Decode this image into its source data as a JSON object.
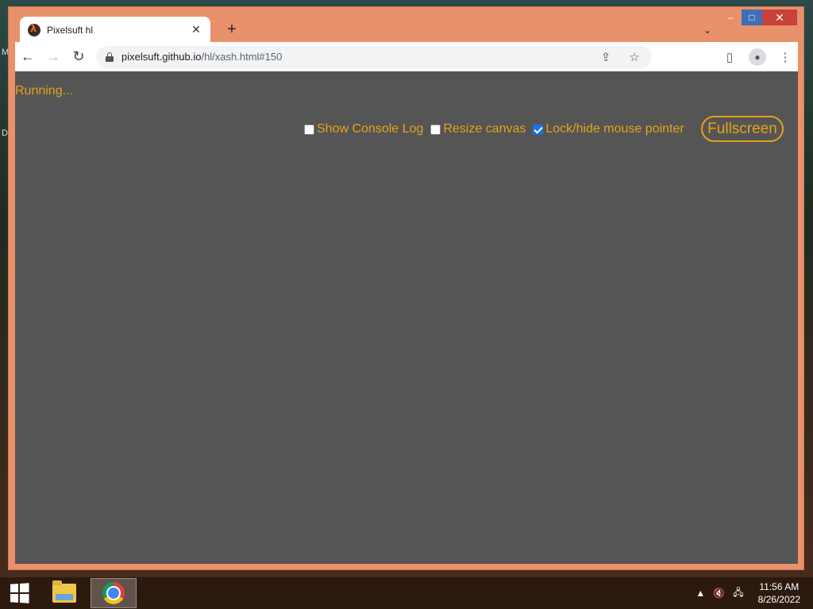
{
  "desktop": {
    "edge_labels": [
      "M",
      "D"
    ]
  },
  "browser": {
    "tab": {
      "title": "Pixelsuft hl",
      "favicon": "half-life-lambda-icon"
    },
    "new_tab_label": "+",
    "tab_search_icon": "chevron-down-icon",
    "caption": {
      "minimize": "–",
      "maximize": "□",
      "close": "✕"
    },
    "nav": {
      "back": "←",
      "forward": "→",
      "reload": "↻"
    },
    "url": {
      "host": "pixelsuft.github.io",
      "path": "/hl/xash.html#150"
    },
    "toolbar_icons": {
      "share": "⇪",
      "bookmark": "☆",
      "side_panel": "▯",
      "profile": "●",
      "menu": "⋮"
    }
  },
  "page": {
    "status": "Running...",
    "options": [
      {
        "label": "Show Console Log",
        "checked": false
      },
      {
        "label": "Resize canvas",
        "checked": false
      },
      {
        "label": "Lock/hide mouse pointer",
        "checked": true
      }
    ],
    "fullscreen_label": "Fullscreen",
    "text_color": "#e6a21a",
    "background_color": "#555555"
  },
  "taskbar": {
    "apps": [
      "file-explorer",
      "google-chrome"
    ],
    "tray_icons": [
      "▲",
      "🔇",
      "🖧"
    ],
    "time": "11:56 AM",
    "date": "8/26/2022"
  }
}
